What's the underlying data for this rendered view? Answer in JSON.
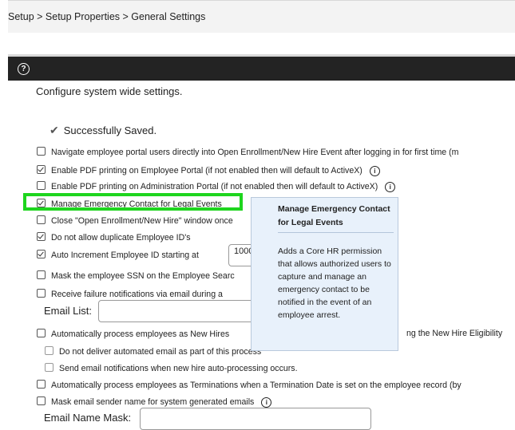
{
  "breadcrumb": "Setup > Setup Properties > General Settings",
  "help_icon": "?",
  "intro": "Configure system wide settings.",
  "saved_icon": "checkmark-icon",
  "saved_message": "Successfully Saved.",
  "settings": [
    {
      "label": "Navigate employee portal users directly into Open Enrollment/New Hire Event after logging in for first time (m",
      "checked": false
    },
    {
      "label": "Enable PDF printing on Employee Portal (if not enabled then will default to ActiveX)",
      "checked": true
    },
    {
      "label": "Enable PDF printing on Administration Portal (if not enabled then will default to ActiveX)",
      "checked": false
    },
    {
      "label": "Manage Emergency Contact for Legal Events",
      "checked": true
    },
    {
      "label": "Close \"Open Enrollment/New Hire\" window once",
      "checked": false
    },
    {
      "label": "Do not allow duplicate Employee ID's",
      "checked": true
    },
    {
      "label": "Auto Increment Employee ID starting at",
      "checked": true
    },
    {
      "label": "Mask the employee SSN on the Employee Searc",
      "checked": false
    },
    {
      "label": "Receive failure notifications via email during a",
      "checked": false
    },
    {
      "label": "Automatically process employees as New Hires",
      "suffix": "ng the New Hire Eligibility",
      "checked": false
    },
    {
      "label": "Do not deliver automated email as part of this process",
      "checked": false
    },
    {
      "label": "Send email notifications when new hire auto-processing occurs.",
      "checked": false
    },
    {
      "label": "Automatically process employees as Terminations when a Termination Date is set on the employee record (by",
      "checked": false
    },
    {
      "label": "Mask email sender name for system generated emails",
      "checked": false
    }
  ],
  "employee_id_start": "1000",
  "email_list_label": "Email List:",
  "email_list_value": "",
  "email_name_mask_label": "Email Name Mask:",
  "email_name_mask_value": "",
  "info_icon": "i",
  "tooltip": {
    "title": "Manage Emergency Contact for Legal Events",
    "body": "Adds a Core HR permission that allows authorized users to capture and manage an emergency contact to be notified in the event of an employee arrest."
  },
  "colors": {
    "highlight": "#1ed51e",
    "titlebar": "#232323",
    "tooltip_bg": "#e8f1fb"
  }
}
